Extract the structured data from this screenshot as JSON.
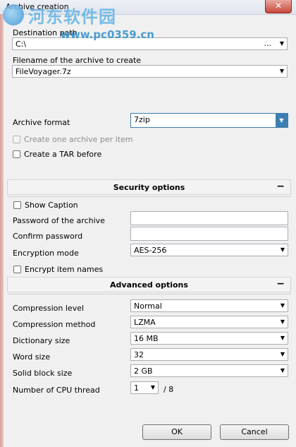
{
  "window": {
    "title": "Archive creation",
    "close_symbol": "✕"
  },
  "watermark": {
    "chinese": "河东软件园",
    "url": "www.pc0359.cn"
  },
  "destination": {
    "label": "Destination path",
    "value": "C:\\",
    "browse": "..."
  },
  "filename": {
    "label": "Filename of the archive to create",
    "value": "FileVoyager.7z"
  },
  "format": {
    "label": "Archive format",
    "value": "7zip"
  },
  "options": {
    "one_per_item": "Create one archive per item",
    "tar_before": "Create a TAR before"
  },
  "security": {
    "title": "Security options",
    "collapse": "−",
    "show_caption": "Show Caption",
    "password_label": "Password of the archive",
    "confirm_label": "Confirm password",
    "encryption_label": "Encryption mode",
    "encryption_value": "AES-256",
    "encrypt_names": "Encrypt item names"
  },
  "advanced": {
    "title": "Advanced options",
    "collapse": "−",
    "level_label": "Compression level",
    "level_value": "Normal",
    "method_label": "Compression method",
    "method_value": "LZMA",
    "dict_label": "Dictionary size",
    "dict_value": "16 MB",
    "word_label": "Word size",
    "word_value": "32",
    "solid_label": "Solid block size",
    "solid_value": "2 GB",
    "cpu_label": "Number of CPU thread",
    "cpu_value": "1",
    "cpu_total": "/ 8"
  },
  "buttons": {
    "ok": "OK",
    "cancel": "Cancel"
  }
}
